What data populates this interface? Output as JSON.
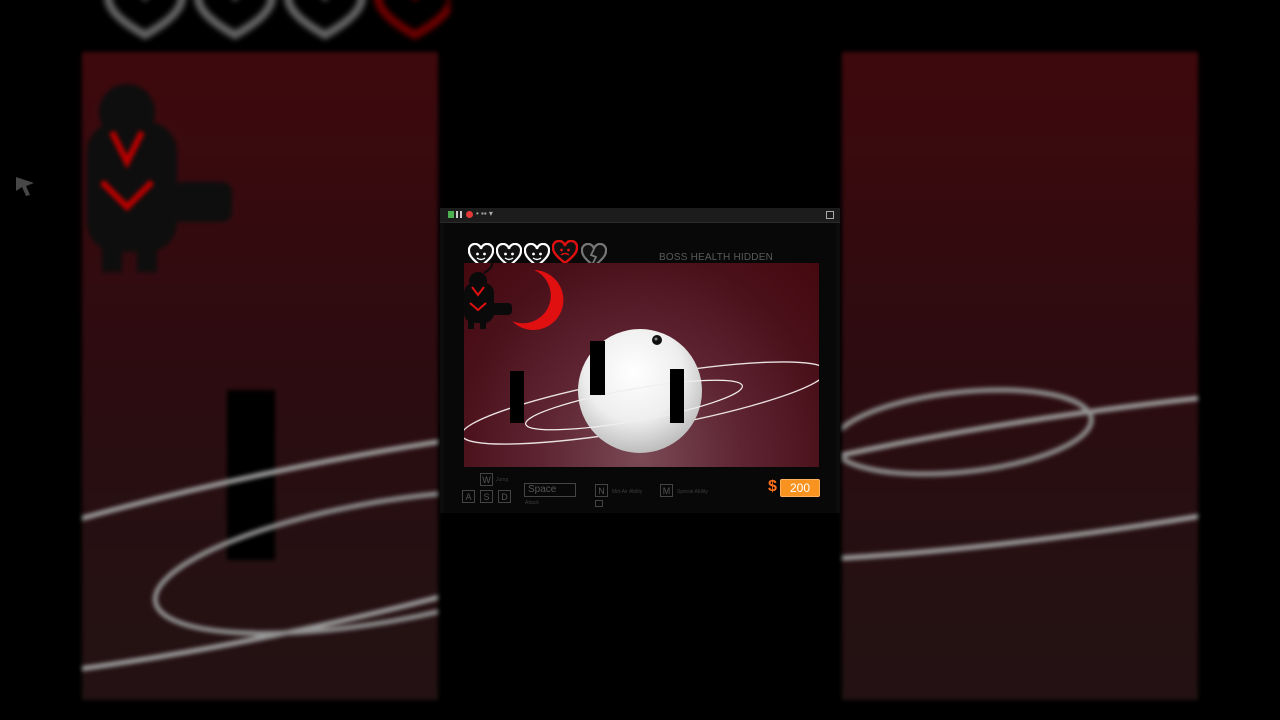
{
  "hud": {
    "boss_health_text": "BOSS HEALTH HIDDEN",
    "hearts": [
      {
        "state": "full",
        "icon": "heart-face-icon"
      },
      {
        "state": "full",
        "icon": "heart-face-icon"
      },
      {
        "state": "full",
        "icon": "heart-face-icon"
      },
      {
        "state": "damaged",
        "icon": "heart-red-icon"
      },
      {
        "state": "broken",
        "icon": "broken-heart-icon"
      }
    ],
    "money_symbol": "$",
    "money_value": "200"
  },
  "controls": {
    "jump_key": "W",
    "jump_label": "Jump",
    "move_keys": [
      "A",
      "S",
      "D"
    ],
    "attack_key": "Space",
    "attack_label": "Attack",
    "midair_key": "N",
    "midair_label": "Mid-Air Ability",
    "special_key": "M",
    "special_label": "Special Ability"
  },
  "colors": {
    "accent_orange": "#f7931e",
    "heart_red": "#e01010",
    "arena_red": "#5e2432"
  }
}
